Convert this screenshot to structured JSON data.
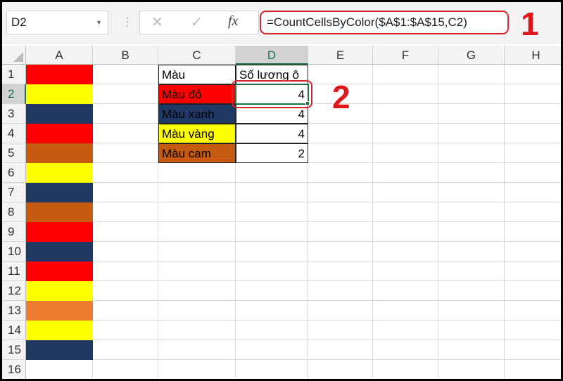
{
  "name_box": "D2",
  "formula": "=CountCellsByColor($A$1:$A$15,C2)",
  "formula_icons": {
    "cancel": "✕",
    "enter": "✓",
    "fx": "fx"
  },
  "annotations": {
    "one": "1",
    "two": "2"
  },
  "columns": [
    "A",
    "B",
    "C",
    "D",
    "E",
    "F",
    "G",
    "H"
  ],
  "rows": [
    "1",
    "2",
    "3",
    "4",
    "5",
    "6",
    "7",
    "8",
    "9",
    "10",
    "11",
    "12",
    "13",
    "14",
    "15",
    "16"
  ],
  "colorA": [
    "#ff0000",
    "#ffff00",
    "#1f3864",
    "#ff0000",
    "#c55a11",
    "#ffff00",
    "#1f3864",
    "#c55a11",
    "#ff0000",
    "#1f3864",
    "#ff0000",
    "#ffff00",
    "#ed7d31",
    "#ffff00",
    "#1f3864",
    ""
  ],
  "table": {
    "header": {
      "c": "Màu",
      "d": "Số lương ô"
    },
    "rows": [
      {
        "c": "Màu đỏ",
        "d": "4",
        "color": "#ff0000"
      },
      {
        "c": "Màu xanh",
        "d": "4",
        "color": "#1f3864"
      },
      {
        "c": "Màu vàng",
        "d": "4",
        "color": "#ffff00"
      },
      {
        "c": "Màu cam",
        "d": "2",
        "color": "#c55a11"
      }
    ]
  },
  "colors": {
    "selection": "#217346",
    "annotation": "#e0161d"
  }
}
